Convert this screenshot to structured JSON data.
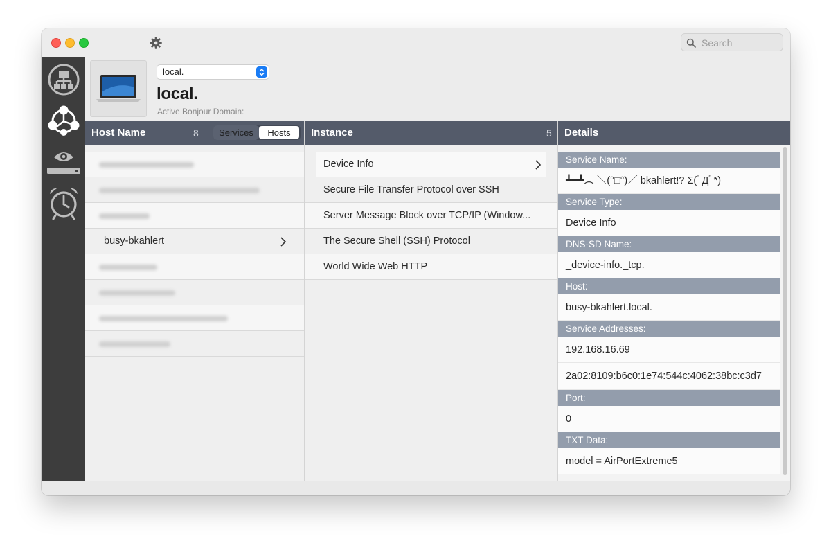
{
  "window": {
    "controls": [
      "close",
      "minimize",
      "zoom"
    ]
  },
  "toolbar": {
    "settings_icon": "gear-icon",
    "search_placeholder": "Search"
  },
  "sidebar": {
    "items": [
      {
        "icon": "network-icon"
      },
      {
        "icon": "bonjour-icon"
      },
      {
        "icon": "eye-icon"
      },
      {
        "icon": "alarm-clock-icon"
      }
    ]
  },
  "domain": {
    "selected": "local.",
    "name": "local.",
    "caption": "Active Bonjour Domain:",
    "device_icon": "laptop-icon"
  },
  "hosts_pane": {
    "title": "Host Name",
    "count": "8",
    "toggle": {
      "services": "Services",
      "hosts": "Hosts",
      "active": "Hosts"
    },
    "rows": [
      {
        "label": "",
        "blurred": true
      },
      {
        "label": "",
        "blurred": true
      },
      {
        "label": "",
        "blurred": true
      },
      {
        "label": "busy-bkahlert",
        "blurred": false,
        "selected": true
      },
      {
        "label": "",
        "blurred": true
      },
      {
        "label": "",
        "blurred": true
      },
      {
        "label": "",
        "blurred": true
      },
      {
        "label": "",
        "blurred": true
      }
    ]
  },
  "instances_pane": {
    "title": "Instance",
    "count": "5",
    "rows": [
      {
        "label": "Device Info",
        "selected": true
      },
      {
        "label": "Secure File Transfer Protocol over SSH"
      },
      {
        "label": "Server Message Block over TCP/IP (Window..."
      },
      {
        "label": "The Secure Shell (SSH) Protocol"
      },
      {
        "label": "World Wide Web HTTP"
      }
    ]
  },
  "details_pane": {
    "title": "Details",
    "sections": [
      {
        "heading": "Service Name:",
        "values": [
          "┻━┻︵ ＼(°□°)／ bkahlert!? Σ(ﾟДﾟ*)"
        ]
      },
      {
        "heading": "Service Type:",
        "values": [
          "Device Info"
        ]
      },
      {
        "heading": "DNS-SD Name:",
        "values": [
          "_device-info._tcp."
        ]
      },
      {
        "heading": "Host:",
        "values": [
          "busy-bkahlert.local."
        ]
      },
      {
        "heading": "Service Addresses:",
        "values": [
          "192.168.16.69",
          "2a02:8109:b6c0:1e74:544c:4062:38bc:c3d7"
        ]
      },
      {
        "heading": "Port:",
        "values": [
          "0"
        ]
      },
      {
        "heading": "TXT Data:",
        "values": [
          "model = AirPortExtreme5"
        ]
      }
    ]
  }
}
